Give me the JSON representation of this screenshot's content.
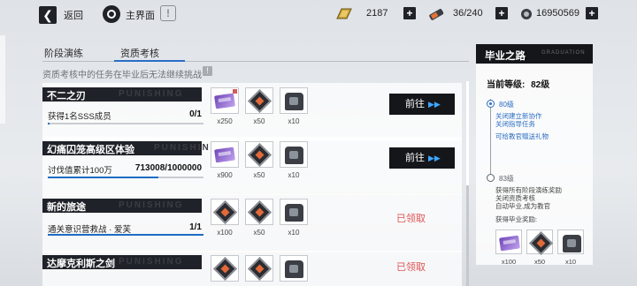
{
  "topbar": {
    "back_label": "返回",
    "home_label": "主界面",
    "resources": [
      {
        "icon": "gold-bar-icon",
        "value": "2187"
      },
      {
        "icon": "stamina-icon",
        "value": "36/240"
      },
      {
        "icon": "coin-icon",
        "value": "16950569"
      }
    ]
  },
  "tabs": [
    {
      "label": "阶段演练",
      "active": false
    },
    {
      "label": "资质考核",
      "active": true
    }
  ],
  "notice": "资质考核中的任务在毕业后无法继续挑战",
  "deco_text": "PUNISHING",
  "tasks": [
    {
      "title": "不二之刃",
      "desc": "获得1名SSS成员",
      "progress": "0/1",
      "progress_fraction": 0.0,
      "rewards": [
        "x250",
        "x50",
        "x10"
      ],
      "action": "前往",
      "status": "go"
    },
    {
      "title": "幻痛囚笼高级区体验",
      "desc": "讨伐值累计100万",
      "progress": "713008/1000000",
      "progress_fraction": 0.713,
      "rewards": [
        "x900",
        "x50",
        "x10"
      ],
      "action": "前往",
      "status": "go"
    },
    {
      "title": "新的旅途",
      "desc": "通关意识营救战 · 爱芙",
      "progress": "1/1",
      "progress_fraction": 1.0,
      "rewards": [
        "x100",
        "x50",
        "x10"
      ],
      "action": "已领取",
      "status": "claimed"
    },
    {
      "title": "达摩克利斯之剑",
      "desc": "",
      "progress": "",
      "progress_fraction": 0.0,
      "rewards": [
        "",
        "",
        ""
      ],
      "action": "已领取",
      "status": "claimed"
    }
  ],
  "panel": {
    "title": "毕业之路",
    "deco": "GRADUATION",
    "current_level_label": "当前等级:",
    "current_level": "82级",
    "milestones": [
      {
        "level": "80级",
        "lines": [
          "关闭建立新协作",
          "关闭指导任务",
          "可给教官赠送礼物"
        ]
      },
      {
        "level": "83级",
        "lines": [
          "获得所有阶段演练奖励",
          "关闭资质考核",
          "自动毕业,成为教官"
        ]
      }
    ],
    "grad_reward_label": "获得毕业奖励:",
    "grad_rewards": [
      "x100",
      "x50",
      "x10"
    ]
  },
  "colors": {
    "accent": "#1c6dc4",
    "claimed": "#e05454",
    "dark": "#14161a"
  }
}
